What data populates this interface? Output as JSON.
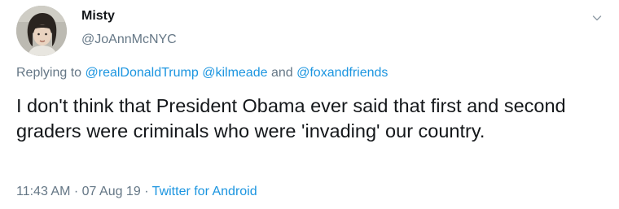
{
  "author": {
    "display_name": "Misty",
    "handle": "@JoAnnMcNYC"
  },
  "reply": {
    "prefix": "Replying to",
    "mention_1": "@realDonaldTrump",
    "mention_2": "@kilmeade",
    "conjunction": "and",
    "mention_3": "@foxandfriends"
  },
  "tweet": {
    "text": "I don't think that President Obama ever said that first and second graders were criminals who were 'invading' our country."
  },
  "meta": {
    "time": "11:43 AM",
    "date": "07 Aug 19",
    "separator": "·",
    "source": "Twitter for Android"
  },
  "icons": {
    "caret": "chevron-down-icon",
    "avatar": "profile-avatar"
  },
  "colors": {
    "link": "#1b95e0",
    "secondary_text": "#657786",
    "primary_text": "#14171a"
  }
}
